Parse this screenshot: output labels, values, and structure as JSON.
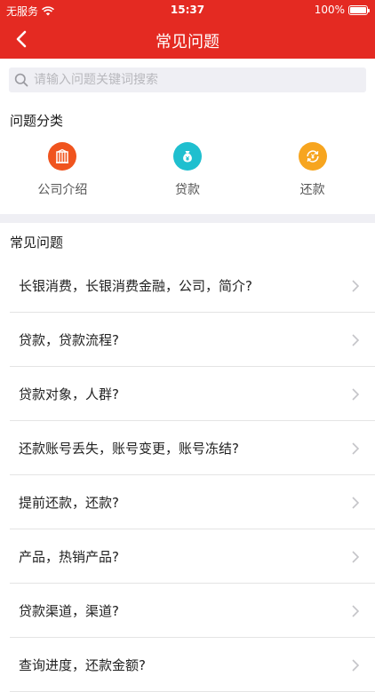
{
  "status": {
    "carrier": "无服务",
    "time": "15:37",
    "battery": "100%"
  },
  "nav": {
    "title": "常见问题"
  },
  "search": {
    "placeholder": "请输入问题关键词搜索"
  },
  "categories_title": "问题分类",
  "categories": [
    {
      "label": "公司介绍",
      "icon": "building-icon",
      "color": "#f0541e"
    },
    {
      "label": "贷款",
      "icon": "money-bag-icon",
      "color": "#1fbfcf"
    },
    {
      "label": "还款",
      "icon": "refresh-yen-icon",
      "color": "#f7a51f"
    }
  ],
  "faq_title": "常见问题",
  "faqs": [
    {
      "text": "长银消费，长银消费金融，公司，简介?"
    },
    {
      "text": "贷款，贷款流程?"
    },
    {
      "text": "贷款对象，人群?"
    },
    {
      "text": "还款账号丢失，账号变更，账号冻结?"
    },
    {
      "text": "提前还款，还款?"
    },
    {
      "text": "产品，热销产品?"
    },
    {
      "text": "贷款渠道，渠道?"
    },
    {
      "text": "查询进度，还款金额?"
    }
  ],
  "colors": {
    "brand": "#e42a22",
    "band": "#efeff4"
  }
}
